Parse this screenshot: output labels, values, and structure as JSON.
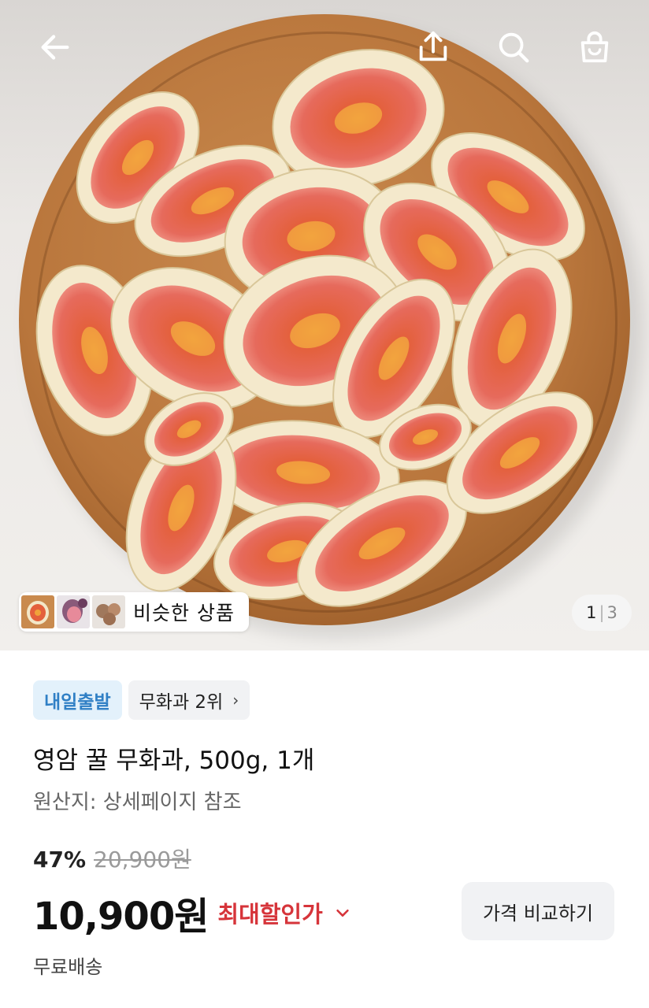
{
  "header": {
    "back_icon": "arrow-left-icon",
    "share_icon": "share-upload-icon",
    "search_icon": "search-icon",
    "cart_icon": "shopping-bag-icon"
  },
  "gallery": {
    "similar_label": "비슷한 상품",
    "pager_current": "1",
    "pager_separator": "|",
    "pager_total": "3"
  },
  "badges": {
    "delivery": "내일출발",
    "rank": "무화과 2위"
  },
  "product": {
    "title": "영암 꿀 무화과, 500g, 1개",
    "origin": "원산지: 상세페이지 참조"
  },
  "pricing": {
    "discount_percent": "47%",
    "original_price": "20,900원",
    "price": "10,900원",
    "max_discount_label": "최대할인가",
    "compare_button": "가격 비교하기",
    "shipping": "무료배송"
  },
  "colors": {
    "accent_red": "#d6343a",
    "badge_blue": "#2f7fc5"
  }
}
